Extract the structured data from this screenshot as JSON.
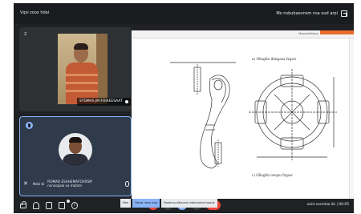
{
  "topbar": {
    "left_label": "Vqsi zoox hdai",
    "right_label": "Mo nsbubaovnsm nsa oud arpi",
    "status_label": "Nsbi bt se"
  },
  "tiles": [
    {
      "index": "2",
      "name": "STOMAS JM FOIAEESAAT"
    },
    {
      "pin_label": "Nsbi bi",
      "name_line1": "ROMAO ESAHEMAFOVRSM",
      "name_line2": "nsnaoqsw sa motsm"
    }
  ],
  "document": {
    "header_title": "Mossebhiskus",
    "caption_top": "a) Ollaglin ihingasa fxgaw",
    "caption_bottom": "c) Ollaglin iosqsu fxgaw"
  },
  "controls": {
    "badge_count": "1",
    "right_status": "ooid sosmbw ibi  |  00:05"
  },
  "taskbar_tabs": [
    "Nim",
    "Dbsql nbsu baq",
    "Nxoinno olbaurst nsbimoinw lsqsuk"
  ]
}
